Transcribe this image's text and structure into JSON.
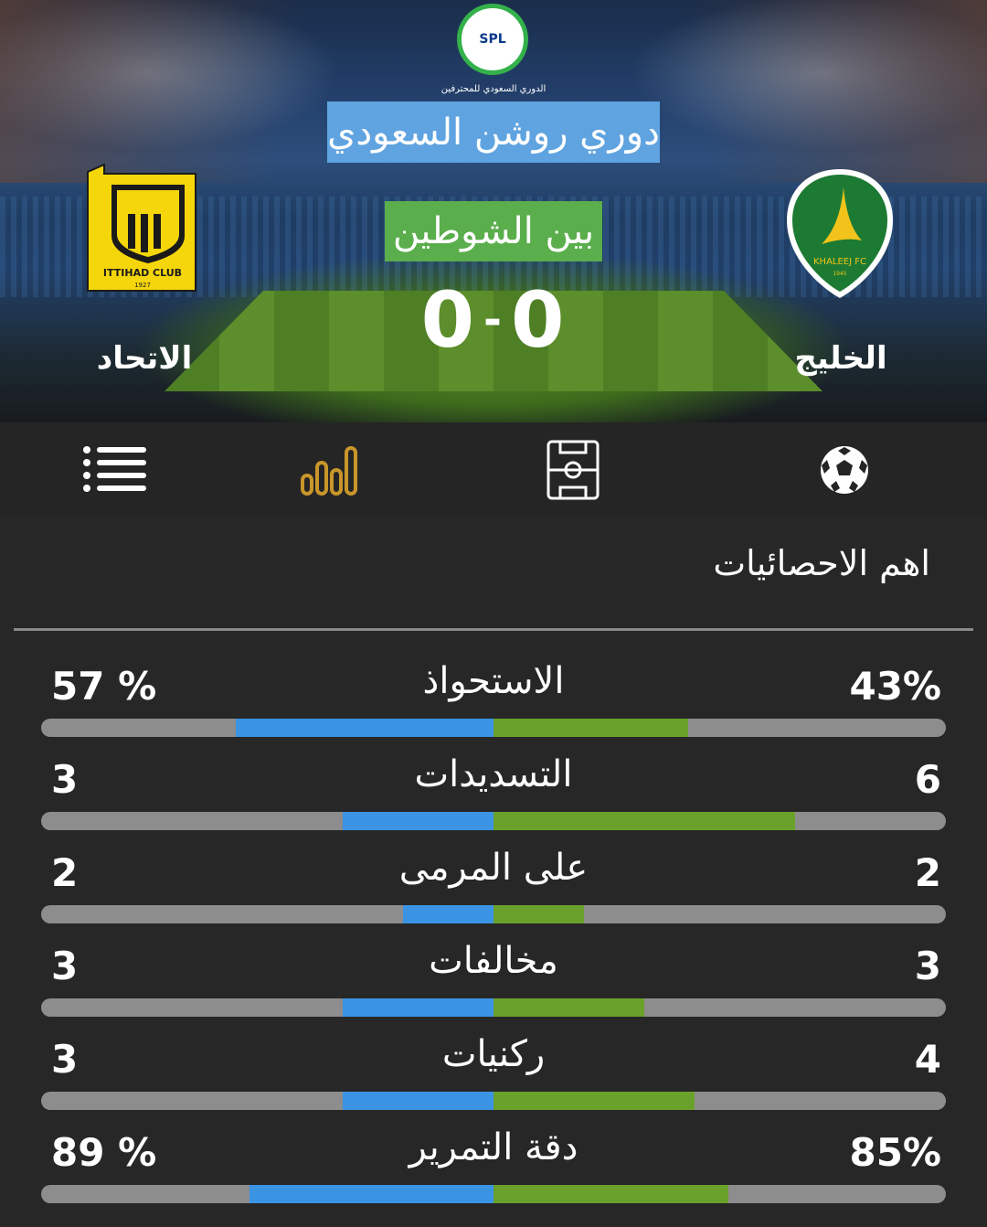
{
  "hero": {
    "league_logo_text": "SPL",
    "league_caption": "الدوري السعودي للمحترفين",
    "league_title": "دوري روشن السعودي",
    "round_title": "بين الشوطين",
    "score_left": "0",
    "score_right": "0",
    "score_separator": "-",
    "team_left": "الاتحاد",
    "team_right": "الخليج",
    "crest_left_text": "ITTIHAD CLUB",
    "crest_left_year": "1927",
    "crest_right_text": "KHALEEJ FC",
    "crest_right_year": "1945"
  },
  "nav": {
    "items": [
      "list-icon",
      "stats-bars-icon",
      "pitch-icon",
      "football-icon"
    ],
    "active_color": "#c9962a",
    "icon_color": "#ffffff"
  },
  "stats": {
    "heading": "اهم الاحصائيات",
    "left_color": "#3b93e4",
    "right_color": "#6aa12b",
    "rows": [
      {
        "label": "الاستحواذ",
        "left": "57 %",
        "right": "43%",
        "left_share": 0.57,
        "right_share": 0.43
      },
      {
        "label": "التسديدات",
        "left": "3",
        "right": "6",
        "left_share": 0.3333,
        "right_share": 0.6667
      },
      {
        "label": "على المرمى",
        "left": "2",
        "right": "2",
        "left_share": 0.2,
        "right_share": 0.2
      },
      {
        "label": "مخالفات",
        "left": "3",
        "right": "3",
        "left_share": 0.3333,
        "right_share": 0.3333
      },
      {
        "label": "ركنيات",
        "left": "3",
        "right": "4",
        "left_share": 0.3333,
        "right_share": 0.4444
      },
      {
        "label": "دقة التمرير",
        "left": "89 %",
        "right": "85%",
        "left_share": 0.54,
        "right_share": 0.52
      }
    ]
  }
}
